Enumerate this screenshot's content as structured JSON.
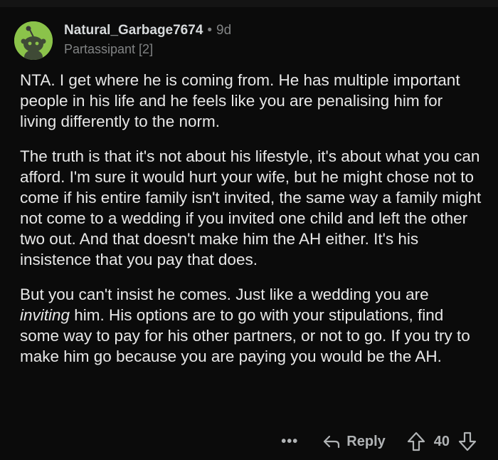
{
  "comment": {
    "username": "Natural_Garbage7674",
    "separator": "•",
    "age": "9d",
    "flair": "Partassipant [2]",
    "avatar_icon": "snoo-avatar-icon",
    "avatar_color": "#8bc34a",
    "paragraphs": [
      "NTA. I get where he is coming from. He has multiple important people in his life and he feels like you are penalising him for living differently to the norm.",
      "The truth is that it's not about his lifestyle, it's about what you can afford. I'm sure it would hurt your wife, but he might chose not to come if his entire family isn't invited, the same way a family might not come to a wedding if you invited one child and left the other two out. And that doesn't make him the AH either. It's his insistence that you pay that does."
    ],
    "p3": {
      "before": "But you can't insist he comes. Just like a wedding you are ",
      "emphasis": "inviting",
      "after": " him. His options are to go with your stipulations, find some way to pay for his other partners, or not to go. If you try to make him go because you are paying you would be the AH."
    }
  },
  "actions": {
    "more_label": "•••",
    "reply_label": "Reply",
    "vote_count": "40",
    "icons": [
      "reply-arrow-icon",
      "upvote-arrow-icon",
      "downvote-arrow-icon"
    ]
  }
}
